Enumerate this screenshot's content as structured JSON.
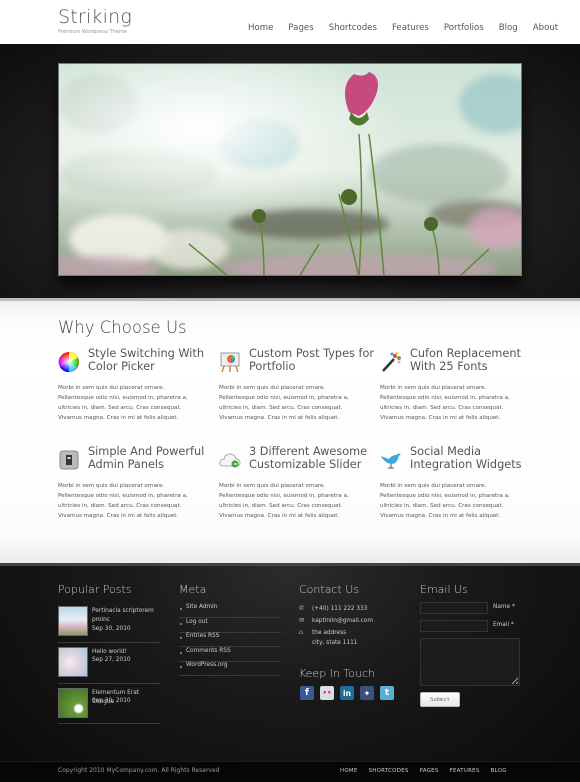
{
  "header": {
    "logo": "Striking",
    "tagline": "Premium Wordpress Theme",
    "nav": [
      "Home",
      "Pages",
      "Shortcodes",
      "Features",
      "Portfolios",
      "Blog",
      "About"
    ]
  },
  "hero": {
    "slide_alt": "Pink cosmos flower against cloudy sky"
  },
  "features": {
    "title": "Why Choose Us",
    "items": [
      {
        "icon": "color-wheel-icon",
        "title": "Style Switching With Color Picker",
        "desc": "Morbi in sem quis dui placerat ornare. Pellentesque odio nisi, euismod in, pharetra a, ultricies in, diam. Sed arcu. Cras consequat. Vivamus magna. Cras in mi at felis aliquet."
      },
      {
        "icon": "easel-chart-icon",
        "title": "Custom Post Types for Portfolio",
        "desc": "Morbi in sem quis dui placerat ornare. Pellentesque odio nisi, euismod in, pharetra a, ultricies in, diam. Sed arcu. Cras consequat. Vivamus magna. Cras in mi at felis aliquet."
      },
      {
        "icon": "magic-wand-icon",
        "title": "Cufon Replacement With 25 Fonts",
        "desc": "Morbi in sem quis dui placerat ornare. Pellentesque odio nisi, euismod in, pharetra a, ultricies in, diam. Sed arcu. Cras consequat. Vivamus magna. Cras in mi at felis aliquet."
      },
      {
        "icon": "admin-panel-icon",
        "title": "Simple And Powerful Admin Panels",
        "desc": "Morbi in sem quis dui placerat ornare. Pellentesque odio nisi, euismod in, pharetra a, ultricies in, diam. Sed arcu. Cras consequat. Vivamus magna. Cras in mi at felis aliquet."
      },
      {
        "icon": "cloud-icon",
        "title": "3 Different Awesome Customizable Slider",
        "desc": "Morbi in sem quis dui placerat ornare. Pellentesque odio nisi, euismod in, pharetra a, ultricies in, diam. Sed arcu. Cras consequat. Vivamus magna. Cras in mi at felis aliquet."
      },
      {
        "icon": "bird-icon",
        "title": "Social Media Integration Widgets",
        "desc": "Morbi in sem quis dui placerat ornare. Pellentesque odio nisi, euismod in, pharetra a, ultricies in, diam. Sed arcu. Cras consequat. Vivamus magna. Cras in mi at felis aliquet."
      }
    ]
  },
  "footer": {
    "popular_posts": {
      "title": "Popular Posts",
      "posts": [
        {
          "title": "Pertinacia scriptorem proinc",
          "date": "Sep 30, 2010"
        },
        {
          "title": "Hello world!",
          "date": "Sep 27, 2010"
        },
        {
          "title": "Elementum Erat Congue",
          "date": "Sep 30, 2010"
        }
      ]
    },
    "meta": {
      "title": "Meta",
      "links": [
        "Site Admin",
        "Log out",
        "Entries RSS",
        "Comments RSS",
        "WordPress.org"
      ]
    },
    "contact": {
      "title": "Contact Us",
      "phone": "(+40) 111 222 333",
      "email": "kaptinlin@gmail.com",
      "address_line1": "the address",
      "address_line2": "city, state  1111"
    },
    "keep_in_touch": {
      "title": "Keep In Touch",
      "networks": [
        {
          "name": "facebook",
          "glyph": "f",
          "color": "#3b5998"
        },
        {
          "name": "flickr",
          "glyph": "••",
          "color": "#d9dde6"
        },
        {
          "name": "linkedin",
          "glyph": "in",
          "color": "#1f6f9c"
        },
        {
          "name": "myspace",
          "glyph": "✦",
          "color": "#3c4f7f"
        },
        {
          "name": "twitter",
          "glyph": "t",
          "color": "#5aaed0"
        }
      ]
    },
    "email_us": {
      "title": "Email Us",
      "name_label": "Name *",
      "email_label": "Email *",
      "name_value": "",
      "email_value": "",
      "message_value": "",
      "submit_label": "Submit"
    }
  },
  "bottom": {
    "copyright": "Copyright  2010 MyCompany.com. All Rights Reserved",
    "nav": [
      "HOME",
      "SHORTCODES",
      "PAGES",
      "FEATURES",
      "BLOG"
    ]
  }
}
